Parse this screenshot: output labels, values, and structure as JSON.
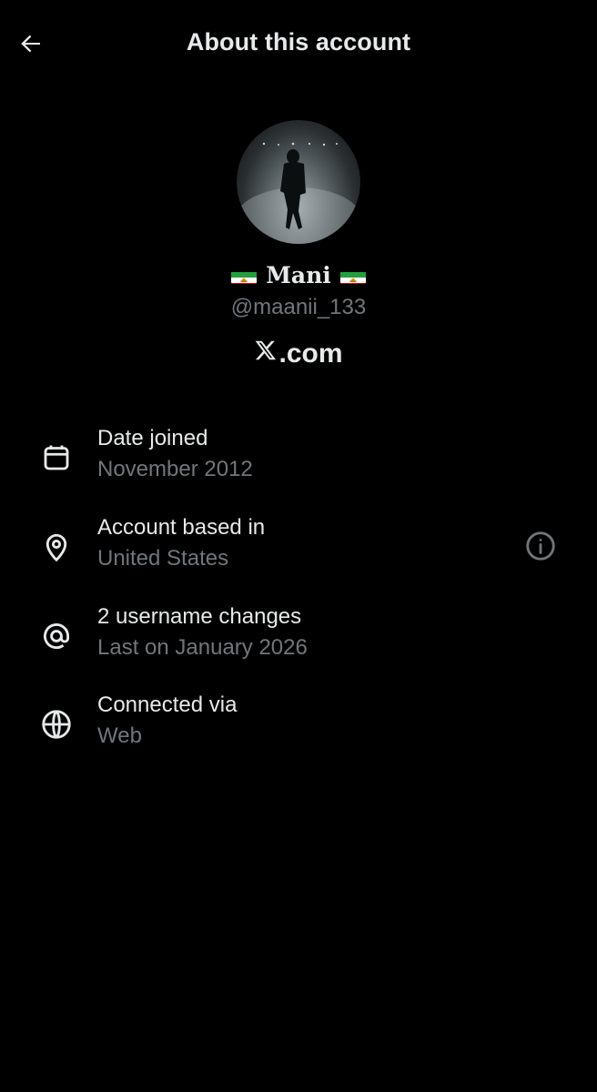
{
  "header": {
    "title": "About this account",
    "back_icon": "arrow-left-icon"
  },
  "profile": {
    "display_name": "Mani",
    "flag_icon": "iran-lion-sun-flag-icon",
    "handle": "@maanii_133",
    "platform": "X.com",
    "platform_suffix": ".com",
    "avatar": "profile-photo"
  },
  "details": [
    {
      "icon": "calendar-icon",
      "label": "Date joined",
      "value": "November 2012"
    },
    {
      "icon": "location-pin-icon",
      "label": "Account based in",
      "value": "United States",
      "info_icon": "info-icon"
    },
    {
      "icon": "at-sign-icon",
      "label": "2 username changes",
      "value": "Last on January 2026"
    },
    {
      "icon": "globe-icon",
      "label": "Connected via",
      "value": "Web"
    }
  ],
  "colors": {
    "background": "#000000",
    "primary_text": "#e7e9ea",
    "secondary_text": "#71767b",
    "flag_green": "#239f40",
    "flag_white": "#ffffff",
    "flag_red": "#da0000",
    "flag_emblem": "#d4a017"
  }
}
